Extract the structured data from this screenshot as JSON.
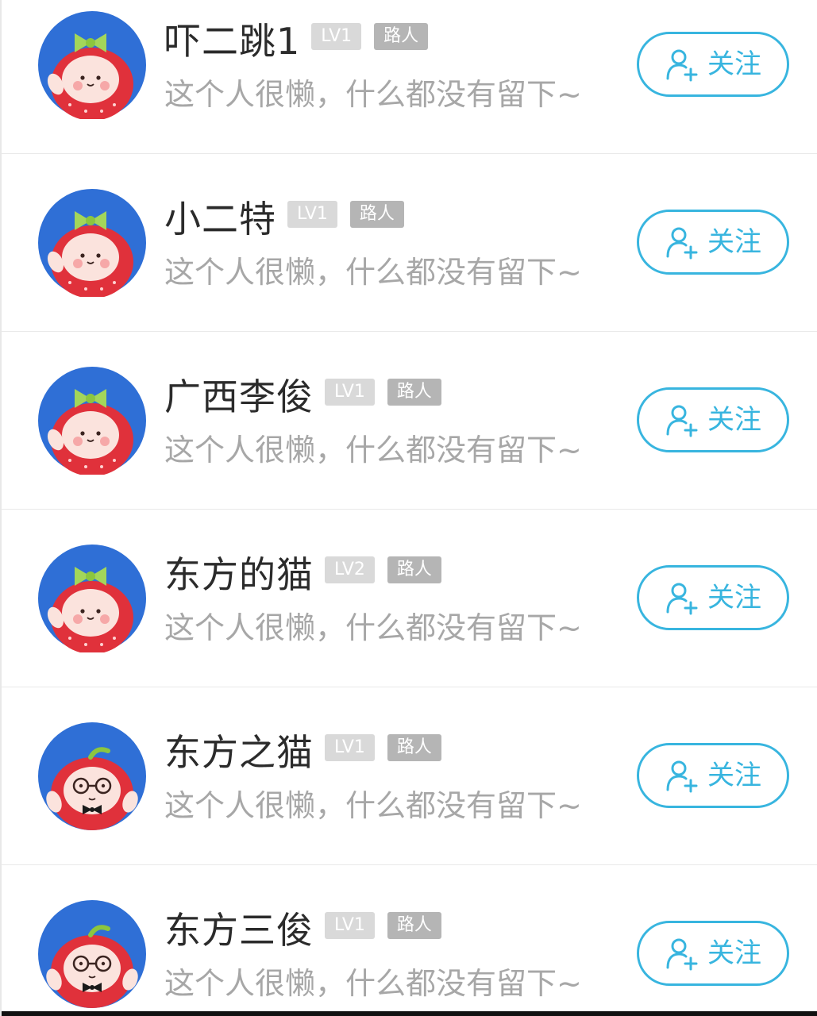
{
  "users": [
    {
      "name": "吓二跳1",
      "level": "LV1",
      "role": "路人",
      "bio": "这个人很懒，什么都没有留下~",
      "follow_label": "关注",
      "avatar_style": "bow"
    },
    {
      "name": "小二特",
      "level": "LV1",
      "role": "路人",
      "bio": "这个人很懒，什么都没有留下~",
      "follow_label": "关注",
      "avatar_style": "bow"
    },
    {
      "name": "广西李俊",
      "level": "LV1",
      "role": "路人",
      "bio": "这个人很懒，什么都没有留下~",
      "follow_label": "关注",
      "avatar_style": "bow"
    },
    {
      "name": "东方的猫",
      "level": "LV2",
      "role": "路人",
      "bio": "这个人很懒，什么都没有留下~",
      "follow_label": "关注",
      "avatar_style": "bow"
    },
    {
      "name": "东方之猫",
      "level": "LV1",
      "role": "路人",
      "bio": "这个人很懒，什么都没有留下~",
      "follow_label": "关注",
      "avatar_style": "glasses"
    },
    {
      "name": "东方三俊",
      "level": "LV1",
      "role": "路人",
      "bio": "这个人很懒，什么都没有留下~",
      "follow_label": "关注",
      "avatar_style": "glasses"
    }
  ],
  "colors": {
    "accent": "#38b5df",
    "avatar_bg": "#2f6fd6",
    "level_badge": "#d9d9d9",
    "role_badge": "#b5b5b5"
  },
  "icons": {
    "follow": "add-user-icon"
  }
}
